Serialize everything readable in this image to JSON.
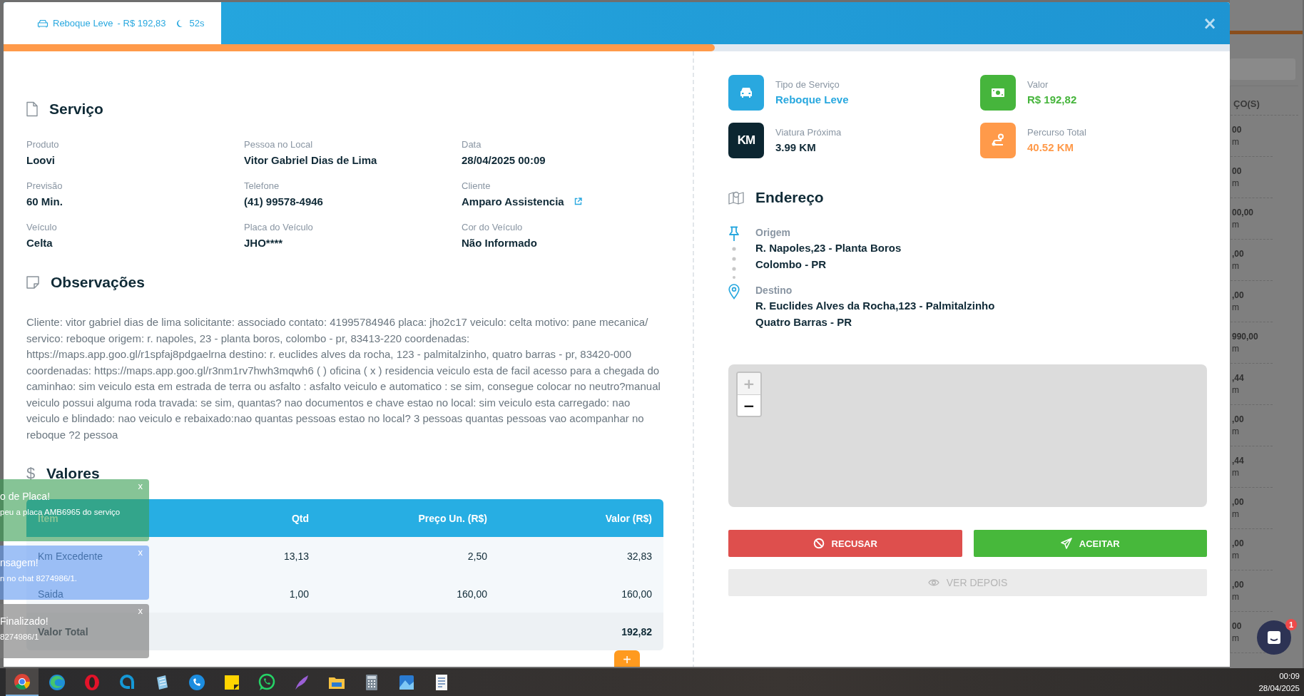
{
  "header": {
    "service": "Reboque Leve",
    "price": "- R$ 192,83",
    "timer": "52s",
    "close": "×",
    "progress": {
      "level": 0.58
    }
  },
  "servico": {
    "title": "Serviço",
    "fields": [
      {
        "label": "Produto",
        "value": "Loovi",
        "link": false
      },
      {
        "label": "Pessoa no Local",
        "value": "Vitor Gabriel Dias de Lima",
        "link": false
      },
      {
        "label": "Data",
        "value": "28/04/2025 00:09",
        "link": false
      },
      {
        "label": "Previsão",
        "value": "60 Min.",
        "link": false
      },
      {
        "label": "Telefone",
        "value": "(41) 99578-4946",
        "link": false
      },
      {
        "label": "Cliente",
        "value": "Amparo Assistencia",
        "link": true
      },
      {
        "label": "Veículo",
        "value": "Celta",
        "link": false
      },
      {
        "label": "Placa do Veículo",
        "value": "JHO****",
        "link": false
      },
      {
        "label": "Cor do Veículo",
        "value": "Não Informado",
        "link": false
      }
    ]
  },
  "observacoes": {
    "title": "Observações",
    "text": "Cliente: vitor gabriel dias de lima solicitante: associado contato: 41995784946 placa: jho2c17 veiculo: celta motivo: pane mecanica/ servico: reboque origem: r. napoles, 23 - planta boros, colombo - pr, 83413-220 coordenadas: https://maps.app.goo.gl/r1spfaj8pdgaelrna destino: r. euclides alves da rocha, 123 - palmitalzinho, quatro barras - pr, 83420-000 coordenadas: https://maps.app.goo.gl/r3nm1rv7hwh3mqwh6 ( ) oficina ( x ) residencia veiculo esta de facil acesso para a chegada do caminhao: sim veiculo esta em estrada de terra ou asfalto : asfalto veiculo e automatico : se sim, consegue colocar no neutro?manual veiculo possui alguma roda travada: se sim, quantas? nao documentos e chave estao no local: sim veiculo esta carregado: nao veiculo e blindado: nao veiculo e rebaixado:nao quantas pessoas estao no local? 3 pessoas quantas pessoas vao acompanhar no reboque ?2 pessoa"
  },
  "valores": {
    "icon": "$",
    "title": "Valores",
    "columns": [
      "Item",
      "Qtd",
      "Preço Un. (R$)",
      "Valor (R$)"
    ],
    "rows": [
      [
        "Km Excedente",
        "13,13",
        "2,50",
        "32,83"
      ],
      [
        "Saida",
        "1,00",
        "160,00",
        "160,00"
      ]
    ],
    "total": {
      "label": "Valor Total",
      "value": "192,82"
    },
    "add_button": "+"
  },
  "stats": [
    {
      "kind": "car",
      "label": "Tipo de Serviço",
      "value": "Reboque Leve",
      "color": "#29a8df"
    },
    {
      "kind": "cash",
      "label": "Valor",
      "value": "R$ 192,82",
      "color": "#46b53c"
    },
    {
      "kind": "badge",
      "badge": "KM",
      "label": "Viatura Próxima",
      "value": "3.99 KM",
      "color": "#0c2631"
    },
    {
      "kind": "route",
      "label": "Percurso Total",
      "value": "40.52 KM",
      "color": "#ff9a4a"
    }
  ],
  "endereco": {
    "title": "Endereço",
    "stops": [
      {
        "kind": "origin",
        "label": "Origem",
        "lines": [
          "R. Napoles,23 - Planta Boros",
          "Colombo - PR"
        ]
      },
      {
        "kind": "destination",
        "label": "Destino",
        "lines": [
          "R. Euclides Alves da Rocha,123 - Palmitalzinho",
          "Quatro Barras - PR"
        ]
      }
    ]
  },
  "map": {
    "zoom_in": {
      "label": "+",
      "disabled": true
    },
    "zoom_out": {
      "label": "−",
      "disabled": false
    }
  },
  "actions": [
    {
      "kind": "refuse",
      "label": "RECUSAR",
      "disabled": false
    },
    {
      "kind": "accept",
      "label": "ACEITAR",
      "disabled": false
    },
    {
      "kind": "later",
      "label": "VER DEPOIS",
      "disabled": true
    }
  ],
  "toasts": [
    {
      "title": "o de Placa!",
      "message": "peu a placa AMB6965 do serviço",
      "kind": "success",
      "close": "x"
    },
    {
      "title": "nsagem!",
      "message": "n no chat 8274986/1.",
      "kind": "info",
      "close": "x"
    },
    {
      "title": "Finalizado!",
      "message": "8274986/1",
      "kind": "neutral",
      "close": "x"
    }
  ],
  "background": {
    "column_header": "ÇO(S)",
    "rows": [
      {
        "value": "00",
        "unit": "m"
      },
      {
        "value": "00",
        "unit": "m"
      },
      {
        "value": "00,00",
        "unit": "m"
      },
      {
        "value": ",00",
        "unit": "m"
      },
      {
        "value": ",00",
        "unit": "m"
      },
      {
        "value": "990,00",
        "unit": "m"
      },
      {
        "value": ",44",
        "unit": "m"
      },
      {
        "value": ",00",
        "unit": "m"
      },
      {
        "value": ",44",
        "unit": "m"
      },
      {
        "value": ",00",
        "unit": "m"
      },
      {
        "value": ",00",
        "unit": "m"
      },
      {
        "value": ",00",
        "unit": "m"
      },
      {
        "value": "00",
        "unit": "m"
      }
    ]
  },
  "chat": {
    "badge": "1"
  },
  "taskbar": {
    "apps": [
      {
        "kind": "chrome",
        "selected": true
      },
      {
        "kind": "edge",
        "selected": false
      },
      {
        "kind": "opera",
        "selected": false
      },
      {
        "kind": "ring",
        "selected": false
      },
      {
        "kind": "notepad",
        "selected": false
      },
      {
        "kind": "phone",
        "selected": false
      },
      {
        "kind": "sticky",
        "selected": false
      },
      {
        "kind": "whatsapp",
        "selected": false
      },
      {
        "kind": "feather",
        "selected": false
      },
      {
        "kind": "folder",
        "selected": false
      },
      {
        "kind": "calculator",
        "selected": false
      },
      {
        "kind": "photos",
        "selected": false
      },
      {
        "kind": "document",
        "selected": false
      }
    ],
    "time": "00:09",
    "date": "28/04/2025"
  }
}
